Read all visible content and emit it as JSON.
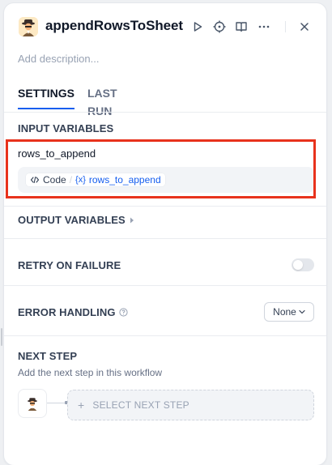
{
  "header": {
    "title": "appendRowsToSheet",
    "icon": "agent-detective-icon",
    "actions": [
      "run-icon",
      "target-icon",
      "book-open-icon",
      "more-icon",
      "close-icon"
    ]
  },
  "description_placeholder": "Add description...",
  "tabs": [
    {
      "label": "SETTINGS",
      "active": true
    },
    {
      "label": "LAST RUN",
      "active": false
    }
  ],
  "input_variables": {
    "title": "INPUT VARIABLES",
    "items": [
      {
        "name": "rows_to_append",
        "source_node": "Code",
        "source_var_icon": "{x}",
        "source_var": "rows_to_append"
      }
    ]
  },
  "output_variables": {
    "title": "OUTPUT VARIABLES"
  },
  "retry": {
    "title": "RETRY ON FAILURE",
    "enabled": false
  },
  "error_handling": {
    "title": "ERROR HANDLING",
    "value": "None"
  },
  "next_step": {
    "title": "NEXT STEP",
    "description": "Add the next step in this workflow",
    "button_label": "SELECT NEXT STEP"
  },
  "colors": {
    "accent": "#155eef",
    "highlight": "#e8321c"
  }
}
